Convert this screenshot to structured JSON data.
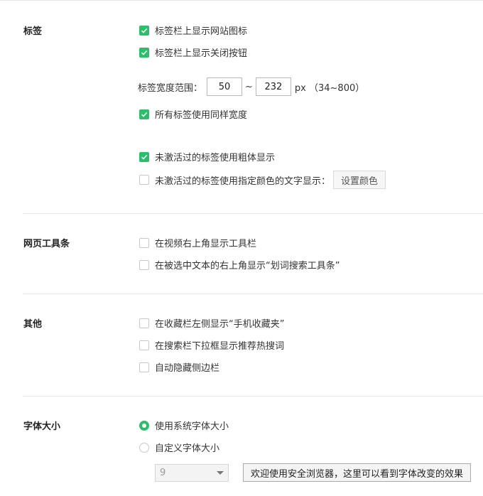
{
  "sections": {
    "tabs": {
      "title": "标签",
      "show_site_icon": "标签栏上显示网站图标",
      "show_close_button": "标签栏上显示关闭按钮",
      "width_range_label": "标签宽度范围：",
      "width_min": "50",
      "tilde": "~",
      "width_max": "232",
      "width_unit": "px （34~800）",
      "same_width": "所有标签使用同样宽度",
      "inactive_bold": "未激活过的标签使用粗体显示",
      "inactive_color": "未激活过的标签使用指定颜色的文字显示：",
      "set_color_button": "设置颜色"
    },
    "toolbar": {
      "title": "网页工具条",
      "video_toolbar": "在视频右上角显示工具栏",
      "search_toolbar": "在被选中文本的右上角显示“划词搜索工具条”"
    },
    "other": {
      "title": "其他",
      "mobile_favorites": "在收藏栏左侧显示“手机收藏夹”",
      "hot_search": "在搜索栏下拉框显示推荐热搜词",
      "auto_hide_sidebar": "自动隐藏侧边栏"
    },
    "font": {
      "title": "字体大小",
      "system_size": "使用系统字体大小",
      "custom_size": "自定义字体大小",
      "size_value": "9",
      "preview_text": "欢迎使用安全浏览器，这里可以看到字体改变的效果"
    }
  },
  "state": {
    "show_site_icon": true,
    "show_close_button": true,
    "same_width": true,
    "inactive_bold": true,
    "inactive_color": false,
    "video_toolbar": false,
    "search_toolbar": false,
    "mobile_favorites": false,
    "hot_search": false,
    "auto_hide_sidebar": false,
    "font_mode": "system"
  },
  "colors": {
    "accent": "#2bbf6a"
  }
}
